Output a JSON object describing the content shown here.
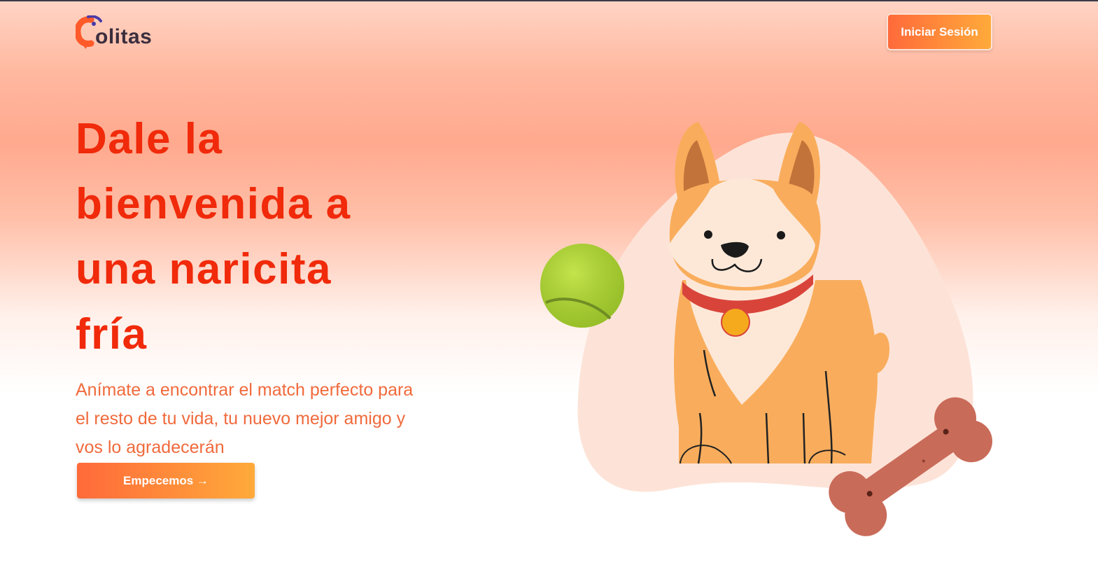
{
  "header": {
    "logo_text": "olitas",
    "login_label": "Iniciar Sesión"
  },
  "hero": {
    "headline": "Dale la bienvenida a una naricita fría",
    "subtitle": "Anímate a encontrar el match perfecto para el resto de tu vida, tu nuevo mejor amigo y vos lo agradecerán",
    "cta_label": "Empecemos →"
  },
  "colors": {
    "accent": "#f02a0a",
    "button_start": "#ff6a3a",
    "button_end": "#ffaa3a",
    "subtitle": "#f06a3c"
  },
  "icons": {
    "logo": "colitas-logo-icon",
    "illustration": "corgi-illustration",
    "ball": "tennis-ball-icon",
    "bone": "dog-bone-icon"
  }
}
